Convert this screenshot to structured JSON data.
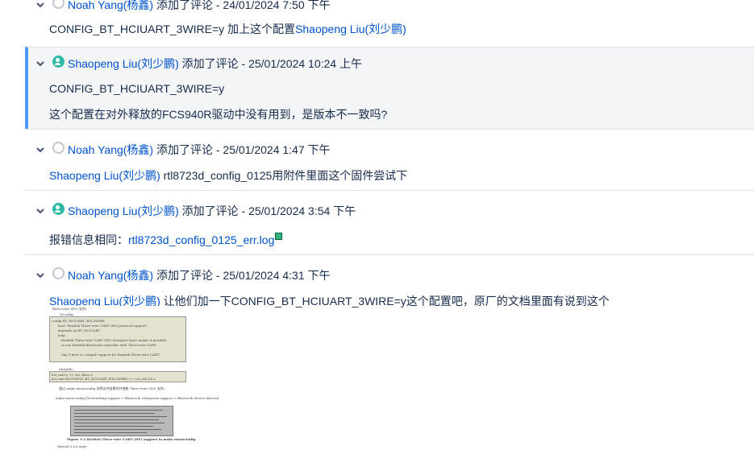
{
  "comments": [
    {
      "author": "Noah Yang(杨鑫)",
      "action": "添加了评论 - 24/01/2024 7:50 下午",
      "avatar": "default-avatar-icon",
      "body": [
        {
          "text": "CONFIG_BT_HCIUART_3WIRE=y 加上这个配置"
        },
        {
          "mention": "Shaopeng Liu(刘少鹏)"
        }
      ]
    },
    {
      "author": "Shaopeng Liu(刘少鹏)",
      "action": "添加了评论 - 25/01/2024 10:24 上午",
      "avatar": "user-avatar-icon",
      "line1": "CONFIG_BT_HCIUART_3WIRE=y",
      "line2": "这个配置在对外释放的FCS940R驱动中没有用到，是版本不一致吗?"
    },
    {
      "author": "Noah Yang(杨鑫)",
      "action": "添加了评论 - 25/01/2024 1:47 下午",
      "mention": "Shaopeng Liu(刘少鹏)",
      "text": " rtl8723d_config_0125用附件里面这个固件尝试下"
    },
    {
      "author": "Shaopeng Liu(刘少鹏)",
      "action": "添加了评论 - 25/01/2024 3:54 下午",
      "text": "报错信息相同：",
      "attachment": "rtl8723d_config_0125_err.log"
    },
    {
      "author": "Noah Yang(杨鑫)",
      "action": "添加了评论 - 25/01/2024 4:31 下午",
      "mention": "Shaopeng Liu(刘少鹏)",
      "text": " 让他们加一下CONFIG_BT_HCIUART_3WIRE=y这个配置吧，原厂的文档里面有说到这个"
    }
  ],
  "embedded_doc": {
    "heading": "Three-wire (H5) 支持。",
    "kconfig_label": "Kconfig:",
    "kconfig_lines": [
      "config BT_HCIUART_RTL3WIRE",
      "bool \"Realtek Three-wire UART (H5) protocol support\"",
      "depends on BT_HCIUART",
      "help",
      "Realtek Three-wire UART (H5) transport layer makes it possible",
      "to use Realtek Bluetooth controller with Three-wire UART.",
      "Say Y here to compile support for Realtek Three-wire UART."
    ],
    "makefile_label": "Makefile:",
    "makefile_lines": [
      "hci_uart-y    += hci_ldisc.o",
      "hci_uart-$(CONFIG_BT_HCIUART_RTL3WIRE)    += hci_rtk_h5.o"
    ],
    "para": "通过 make menuconfig 选择支持该模块并使能 Three-wire (H5) 支持。",
    "menu_path": "make menuconfig [Networking support > Bluetooth subsystem support > Bluetooth device drivers]",
    "figure_caption": "Figure 1-2 Realtek Three-wire UART (H5) support in make menuconfig",
    "footer": "(kernel-3.x.x only)"
  }
}
